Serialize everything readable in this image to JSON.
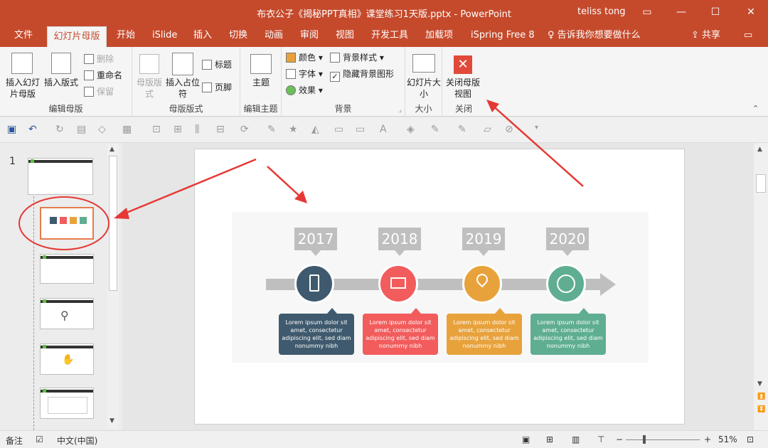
{
  "title_bar": {
    "title": "布衣公子《揭秘PPT真相》课堂练习1天版.pptx - PowerPoint",
    "user": "teliss tong"
  },
  "tabs": [
    {
      "label": "文件"
    },
    {
      "label": "幻灯片母版"
    },
    {
      "label": "开始"
    },
    {
      "label": "iSlide"
    },
    {
      "label": "插入"
    },
    {
      "label": "切换"
    },
    {
      "label": "动画"
    },
    {
      "label": "审阅"
    },
    {
      "label": "视图"
    },
    {
      "label": "开发工具"
    },
    {
      "label": "加载项"
    },
    {
      "label": "iSpring Free 8"
    }
  ],
  "tell_me": "告诉我你想要做什么",
  "share": "共享",
  "ribbon": {
    "edit_master": {
      "insert_slide_master": "插入幻灯片母版",
      "insert_layout": "插入版式",
      "delete": "删除",
      "rename": "重命名",
      "preserve": "保留",
      "label": "编辑母版"
    },
    "master_layout": {
      "master_layout": "母版版式",
      "insert_placeholder": "插入占位符",
      "title": "标题",
      "footer": "页脚",
      "label": "母版版式"
    },
    "edit_theme": {
      "themes": "主题",
      "label": "编辑主题"
    },
    "background": {
      "colors": "颜色",
      "fonts": "字体",
      "effects": "效果",
      "bg_styles": "背景样式",
      "hide_bg": "隐藏背景图形",
      "label": "背景"
    },
    "size": {
      "slide_size": "幻灯片大小",
      "label": "大小"
    },
    "close": {
      "close_master": "关闭母版视图",
      "label": "关闭"
    }
  },
  "thumbs": {
    "slide_number": "1"
  },
  "timeline": {
    "items": [
      {
        "year": "2017",
        "color": "#3f5a6e",
        "text": "Lorem ipsum dolor sit amet, consectetur adipiscing elit, sed diam nonummy nibh"
      },
      {
        "year": "2018",
        "color": "#f25c5c",
        "text": "Lorem ipsum dolor sit amet, consectetur adipiscing elit, sed diam nonummy nibh"
      },
      {
        "year": "2019",
        "color": "#e8a23c",
        "text": "Lorem ipsum dolor sit amet, consectetur adipiscing elit, sed diam nonummy nibh"
      },
      {
        "year": "2020",
        "color": "#5fae92",
        "text": "Lorem ipsum dolor sit amet, consectetur adipiscing elit, sed diam nonummy nibh"
      }
    ],
    "track_color": "#bfbfbf"
  },
  "status": {
    "notes": "备注",
    "language": "中文(中国)",
    "zoom": "51%"
  },
  "colors": {
    "accent": "#c54a2c",
    "annotation": "#e53935"
  }
}
